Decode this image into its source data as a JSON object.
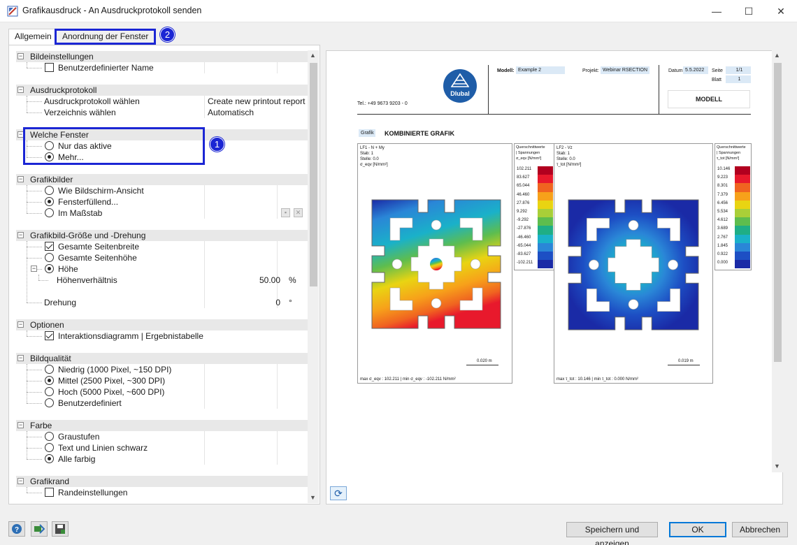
{
  "window": {
    "title": "Grafikausdruck - An Ausdruckprotokoll senden",
    "minimize_glyph": "—",
    "maximize_glyph": "☐",
    "close_glyph": "✕"
  },
  "tabs": [
    {
      "label": "Allgemein",
      "active": true
    },
    {
      "label": "Anordnung der Fenster",
      "active": false
    }
  ],
  "callouts": {
    "tab": "2",
    "section": "1"
  },
  "settings": {
    "bildeinstellungen": {
      "title": "Bildeinstellungen",
      "custom_name": "Benutzerdefinierter Name",
      "custom_name_checked": false
    },
    "ausdruckprotokoll": {
      "title": "Ausdruckprotokoll",
      "choose_label": "Ausdruckprotokoll wählen",
      "choose_value": "Create new printout report",
      "dir_label": "Verzeichnis wählen",
      "dir_value": "Automatisch"
    },
    "welche_fenster": {
      "title": "Welche Fenster",
      "only_active": "Nur das aktive",
      "more": "Mehr...",
      "selected": "more"
    },
    "grafikbilder": {
      "title": "Grafikbilder",
      "screen_view": "Wie Bildschirm-Ansicht",
      "fill_window": "Fensterfüllend...",
      "scale": "Im Maßstab",
      "selected": "fill_window"
    },
    "groesse": {
      "title": "Grafikbild-Größe und -Drehung",
      "full_width": "Gesamte Seitenbreite",
      "full_width_checked": true,
      "full_height": "Gesamte Seitenhöhe",
      "height": "Höhe",
      "height_ratio_label": "Höhenverhältnis",
      "height_ratio_value": "50.00",
      "height_ratio_unit": "%",
      "rotation_label": "Drehung",
      "rotation_value": "0",
      "rotation_unit": "°"
    },
    "optionen": {
      "title": "Optionen",
      "interaction": "Interaktionsdiagramm | Ergebnistabelle",
      "interaction_checked": true
    },
    "bildqualitaet": {
      "title": "Bildqualität",
      "low": "Niedrig (1000 Pixel, ~150 DPI)",
      "medium": "Mittel (2500 Pixel, ~300 DPI)",
      "high": "Hoch (5000 Pixel, ~600 DPI)",
      "custom": "Benutzerdefiniert",
      "selected": "medium"
    },
    "farbe": {
      "title": "Farbe",
      "grayscale": "Graustufen",
      "bw": "Text und Linien schwarz",
      "all_color": "Alle farbig",
      "selected": "all_color"
    },
    "grafikrand": {
      "title": "Grafikrand",
      "border_settings": "Randeinstellungen",
      "border_checked": false
    }
  },
  "preview": {
    "logo_text": "Dlubal",
    "phone": "Tel.: +49 9673 9203 - 0",
    "model_label": "Modell:",
    "model_value": "Example 2",
    "project_label": "Projekt:",
    "project_value": "Webinar RSECTION",
    "date_label": "Datum",
    "date_value": "5.5.2022",
    "page_label": "Seite",
    "page_value": "1/1",
    "sheet_label": "Blatt",
    "sheet_value": "1",
    "section_box": "MODELL",
    "tag": "Grafik",
    "heading": "KOMBINIERTE GRAFIK",
    "left_graphic": {
      "info": [
        "LF1 - N + My",
        "Stab: 1",
        "Stelle: 0.0",
        "σ_eqv [N/mm²]"
      ],
      "legend_title": [
        "Querschnittwerte",
        "| Spannungen",
        "σ_eqv [N/mm²]"
      ],
      "legend_values": [
        "102.211",
        "83.627",
        "65.044",
        "46.460",
        "27.876",
        "9.292",
        "-9.292",
        "-27.876",
        "-46.460",
        "-65.044",
        "-83.627",
        "-102.211"
      ],
      "scale_text": "0.020 m",
      "footer": "max σ_eqv : 102.211 | min σ_eqv : -102.211 N/mm²"
    },
    "right_graphic": {
      "info": [
        "LF2 - Vz",
        "Stab: 1",
        "Stelle: 0.0",
        "τ_tot [N/mm²]"
      ],
      "legend_title": [
        "Querschnittwerte",
        "| Spannungen",
        "τ_tot [N/mm²]"
      ],
      "legend_values": [
        "10.146",
        "9.223",
        "8.301",
        "7.379",
        "6.456",
        "5.534",
        "4.612",
        "3.689",
        "2.767",
        "1.845",
        "0.922",
        "0.000"
      ],
      "scale_text": "0.019 m",
      "footer": "max τ_tot : 10.146 | min τ_tot : 0.000 N/mm²"
    },
    "legend_colors_left": [
      "#b2001f",
      "#e8192c",
      "#f06420",
      "#f7a11a",
      "#e9d412",
      "#a9cf38",
      "#5ebd4e",
      "#1fae86",
      "#1ab1c9",
      "#2a86d7",
      "#1d4fc4",
      "#1a2aa6"
    ],
    "legend_colors_right": [
      "#b2001f",
      "#e8192c",
      "#f06420",
      "#f7a11a",
      "#e9d412",
      "#a9cf38",
      "#5ebd4e",
      "#1fae86",
      "#1ab1c9",
      "#2a86d7",
      "#1d4fc4",
      "#1a2aa6"
    ]
  },
  "footer": {
    "save_show": "Speichern und anzeigen",
    "ok": "OK",
    "cancel": "Abbrechen"
  },
  "colors": {
    "accent": "#1b26d4",
    "ok_border": "#0078d7",
    "group_bg": "#e8e8e8"
  }
}
